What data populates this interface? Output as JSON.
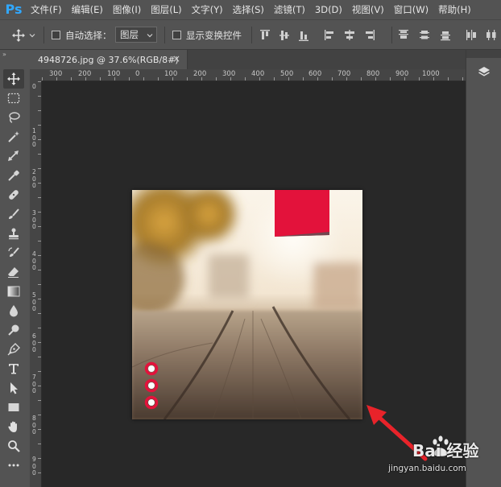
{
  "app": {
    "logo": "Ps"
  },
  "menu": [
    "文件(F)",
    "编辑(E)",
    "图像(I)",
    "图层(L)",
    "文字(Y)",
    "选择(S)",
    "滤镜(T)",
    "3D(D)",
    "视图(V)",
    "窗口(W)",
    "帮助(H)"
  ],
  "options": {
    "auto_select_label": "自动选择：",
    "auto_select_target": "图层",
    "show_transform_label": "显示变换控件"
  },
  "document_tab": {
    "title": "4948726.jpg @ 37.6%(RGB/8#)",
    "close": "×"
  },
  "ruler": {
    "h_labels": [
      "300",
      "200",
      "100",
      "0",
      "100",
      "200",
      "300",
      "400",
      "500",
      "600",
      "700",
      "800",
      "900",
      "1000"
    ],
    "v_labels": [
      "0",
      "100",
      "200",
      "300",
      "400",
      "500",
      "600",
      "700",
      "800",
      "900"
    ]
  },
  "watermark": {
    "brand": "Bai 经验",
    "url": "jingyan.baidu.com"
  },
  "colors": {
    "accent": "#31a8ff",
    "ribbon": "#e3123b",
    "arrow": "#e8232a",
    "panel": "#535353"
  },
  "icons": [
    "move-icon",
    "marquee-icon",
    "lasso-icon",
    "magic-wand-icon",
    "crop-icon",
    "eyedropper-icon",
    "healing-brush-icon",
    "brush-icon",
    "clone-stamp-icon",
    "history-brush-icon",
    "eraser-icon",
    "gradient-icon",
    "blur-icon",
    "dodge-icon",
    "pen-icon",
    "type-icon",
    "path-select-icon",
    "rectangle-icon",
    "hand-icon",
    "zoom-icon",
    "more-icon",
    "layers-icon"
  ]
}
